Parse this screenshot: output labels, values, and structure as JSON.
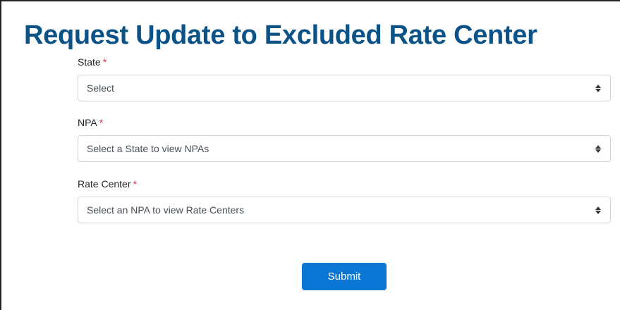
{
  "form": {
    "title": "Request Update to Excluded Rate Center",
    "required_marker": "*",
    "fields": [
      {
        "label": "State",
        "value": "Select"
      },
      {
        "label": "NPA",
        "value": "Select a State to view NPAs"
      },
      {
        "label": "Rate Center",
        "value": "Select an NPA to view Rate Centers"
      }
    ],
    "submit_label": "Submit"
  },
  "icons": {
    "select_arrow": "up-down-chevron-icon"
  },
  "colors": {
    "title": "#0b5286",
    "required": "#dc3545",
    "button": "#0a77d5"
  }
}
